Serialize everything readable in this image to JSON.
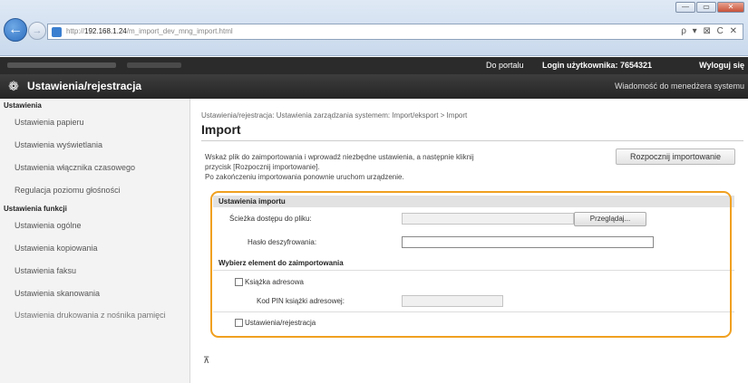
{
  "browser": {
    "url_host": "192.168.1.24",
    "url_path": "/m_import_dev_mng_import.html",
    "url_prefix": "http://",
    "url_controls": "ρ ▾ ⊠ C ✕",
    "back_icon": "arrow-left-icon",
    "forward_icon": "arrow-right-icon",
    "window_buttons": [
      "—",
      "▭",
      "✕"
    ]
  },
  "topbar": {
    "portal_link": "Do portalu",
    "login_label": "Login użytkownika:  7654321",
    "logout_link": "Wyloguj się"
  },
  "titlebar": {
    "title": "Ustawienia/rejestracja",
    "message": "Wiadomość do menedżera systemu",
    "icon": "settings-gear-icon"
  },
  "sidebar": {
    "group1": "Ustawienia",
    "items1": [
      "Ustawienia papieru",
      "Ustawienia wyświetlania",
      "Ustawienia włącznika czasowego",
      "Regulacja poziomu głośności"
    ],
    "group2": "Ustawienia funkcji",
    "items2": [
      "Ustawienia ogólne",
      "Ustawienia kopiowania",
      "Ustawienia faksu",
      "Ustawienia skanowania",
      "Ustawienia drukowania z nośnika pamięci"
    ]
  },
  "main": {
    "breadcrumb": "Ustawienia/rejestracja: Ustawienia zarządzania systemem: Import/eksport > Import",
    "title": "Import",
    "description_line1": "Wskaż plik do zaimportowania i wprowadź niezbędne ustawienia, a następnie kliknij",
    "description_line2": "przycisk [Rozpocznij importowanie].",
    "description_line3": "Po zakończeniu importowania ponownie uruchom urządzenie.",
    "start_button": "Rozpocznij importowanie",
    "import_settings_header": "Ustawienia importu",
    "file_path_label": "Ścieżka dostępu do pliku:",
    "browse_button": "Przeglądaj...",
    "password_label": "Hasło deszyfrowania:",
    "password_value": "",
    "select_header": "Wybierz element do zaimportowania",
    "address_book_label": "Książka adresowa",
    "address_book_checked": false,
    "pin_label": "Kod PIN książki adresowej:",
    "settings_label": "Ustawienia/rejestracja",
    "settings_checked": false,
    "to_top": "⊼"
  },
  "colors": {
    "highlight": "#f0a020",
    "titlebar": "#2b2b2b",
    "back_button": "#2c6dbf"
  }
}
